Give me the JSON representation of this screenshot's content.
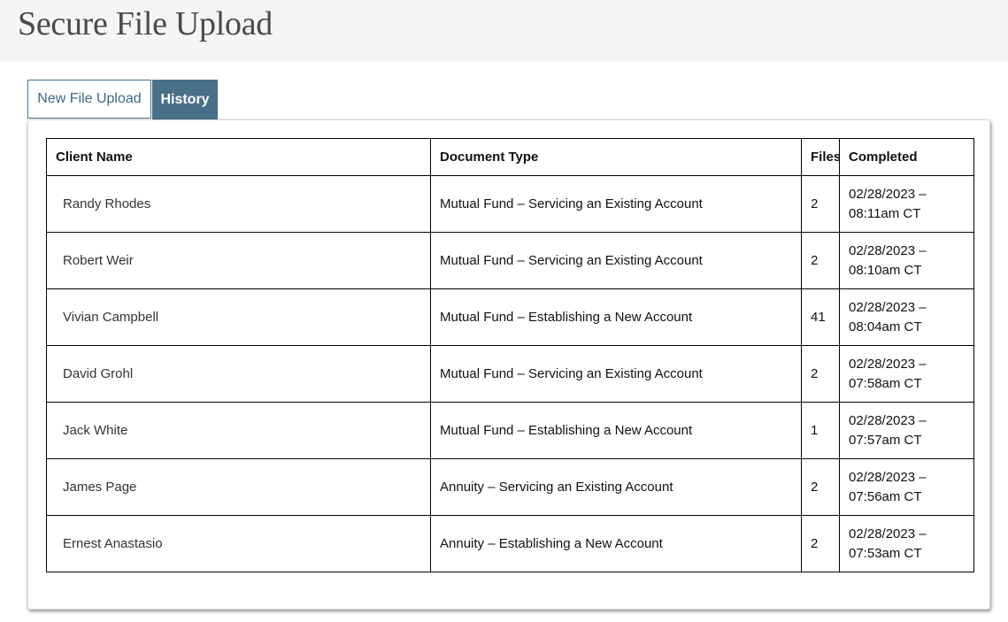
{
  "page": {
    "title": "Secure File Upload"
  },
  "tabs": [
    {
      "label": "New File Upload",
      "active": false
    },
    {
      "label": "History",
      "active": true
    }
  ],
  "table": {
    "headers": {
      "client_name": "Client Name",
      "document_type": "Document Type",
      "files": "Files",
      "completed": "Completed"
    },
    "rows": [
      {
        "client_name": "Randy Rhodes",
        "document_type": "Mutual Fund – Servicing an Existing Account",
        "files": "2",
        "completed_date": "02/28/2023 –",
        "completed_time": "08:11am CT"
      },
      {
        "client_name": "Robert Weir",
        "document_type": "Mutual Fund – Servicing an Existing Account",
        "files": "2",
        "completed_date": "02/28/2023 –",
        "completed_time": "08:10am CT"
      },
      {
        "client_name": "Vivian Campbell",
        "document_type": "Mutual Fund – Establishing a New Account",
        "files": "41",
        "completed_date": "02/28/2023 –",
        "completed_time": "08:04am CT"
      },
      {
        "client_name": "David Grohl",
        "document_type": "Mutual Fund – Servicing an Existing Account",
        "files": "2",
        "completed_date": "02/28/2023 –",
        "completed_time": "07:58am CT"
      },
      {
        "client_name": "Jack White",
        "document_type": "Mutual Fund – Establishing a New Account",
        "files": "1",
        "completed_date": "02/28/2023 –",
        "completed_time": "07:57am CT"
      },
      {
        "client_name": "James Page",
        "document_type": "Annuity – Servicing an Existing Account",
        "files": "2",
        "completed_date": "02/28/2023 –",
        "completed_time": "07:56am CT"
      },
      {
        "client_name": "Ernest Anastasio",
        "document_type": "Annuity – Establishing a New Account",
        "files": "2",
        "completed_date": "02/28/2023 –",
        "completed_time": "07:53am CT"
      }
    ]
  },
  "colors": {
    "accent": "#4a7088",
    "header_bg": "#f5f5f5",
    "title_text": "#4a4a4a"
  }
}
